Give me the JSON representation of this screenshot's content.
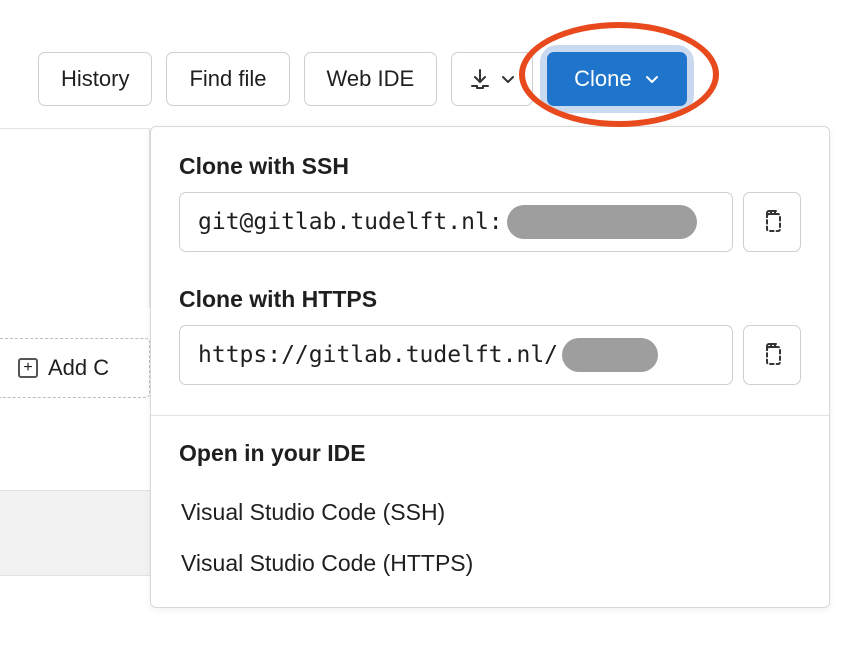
{
  "toolbar": {
    "history": "History",
    "find_file": "Find file",
    "web_ide": "Web IDE",
    "clone": "Clone"
  },
  "dropdown": {
    "ssh_label": "Clone with SSH",
    "ssh_url": "git@gitlab.tudelft.nl:",
    "https_label": "Clone with HTTPS",
    "https_url": "https://gitlab.tudelft.nl/",
    "ide_title": "Open in your IDE",
    "ide_items": [
      "Visual Studio Code (SSH)",
      "Visual Studio Code (HTTPS)"
    ]
  },
  "background": {
    "add_label": "Add C"
  },
  "colors": {
    "primary": "#1f75cb",
    "highlight": "#e8491d",
    "focus_ring": "#c8d9f0"
  }
}
